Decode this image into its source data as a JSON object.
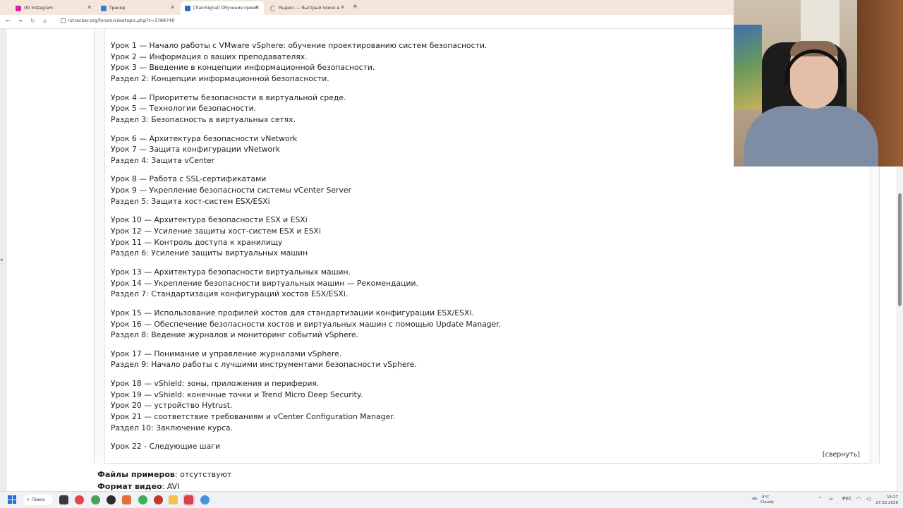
{
  "tabs": [
    {
      "title": "(8) Instagram",
      "icon": "instagram-icon",
      "color": "#d6249f"
    },
    {
      "title": "Трекер",
      "icon": "tracker-icon",
      "color": "#3a7bd5"
    },
    {
      "title": "[TrainSignal] Обучение проект",
      "icon": "rutracker-icon",
      "color": "#2e6bb8"
    },
    {
      "title": "Яндекс — быстрый поиск в и",
      "icon": "loading-icon",
      "color": "#888888"
    }
  ],
  "address": {
    "url": "rutracker.org/forum/viewtopic.php?t=3788740"
  },
  "lesson_groups": [
    [
      "Урок 1 — Начало работы с VMware vSphere: обучение проектированию систем безопасности.",
      "Урок 2 — Информация о ваших преподавателях.",
      "Урок 3 — Введение в концепции информационной безопасности.",
      "Раздел 2: Концепции информационной безопасности."
    ],
    [
      "Урок 4 — Приоритеты безопасности в виртуальной среде.",
      "Урок 5 — Технологии безопасности.",
      "Раздел 3: Безопасность в виртуальных сетях."
    ],
    [
      "Урок 6 — Архитектура безопасности vNetwork",
      "Урок 7 — Защита конфигурации vNetwork",
      "Раздел 4: Защита vCenter"
    ],
    [
      "Урок 8 — Работа с SSL-сертификатами",
      "Урок 9 — Укрепление безопасности системы vCenter Server",
      "Раздел 5: Защита хост-систем ESX/ESXi"
    ],
    [
      "Урок 10 — Архитектура безопасности ESX и ESXi",
      "Урок 12 — Усиление защиты хост-систем ESX и ESXi",
      "Урок 11 — Контроль доступа к хранилищу",
      "Раздел 6: Усиление защиты виртуальных машин"
    ],
    [
      "Урок 13 — Архитектура безопасности виртуальных машин.",
      "Урок 14 — Укрепление безопасности виртуальных машин — Рекомендации.",
      "Раздел 7: Стандартизация конфигураций хостов ESX/ESXi."
    ],
    [
      "Урок 15 — Использование профилей хостов для стандартизации конфигурации ESX/ESXi.",
      "Урок 16 — Обеспечение безопасности хостов и виртуальных машин с помощью Update Manager.",
      "Раздел 8: Ведение журналов и мониторинг событий vSphere."
    ],
    [
      "Урок 17 — Понимание и управление журналами vSphere.",
      "Раздел 9: Начало работы с лучшими инструментами безопасности vSphere."
    ],
    [
      "Урок 18 — vShield: зоны, приложения и периферия.",
      "Урок 19 — vShield: конечные точки и Trend Micro Deep Security.",
      "Урок 20 — устройство Hytrust.",
      "Урок 21 — соответствие требованиям и vCenter Configuration Manager.",
      "Раздел 10: Заключение курса."
    ],
    [
      "Урок 22 - Следующие шаги"
    ]
  ],
  "collapse_link": "[свернуть]",
  "meta": {
    "samples_label": "Файлы примеров",
    "samples_value": ": отсутствуют",
    "format_label": "Формат видео",
    "format_value": ": AVI"
  },
  "taskbar": {
    "search_label": "Поиск",
    "weather_temp": "-4°C",
    "weather_desc": "Cloudy",
    "lang": "РУС",
    "time": "15:27",
    "date": "27.02.2026"
  }
}
